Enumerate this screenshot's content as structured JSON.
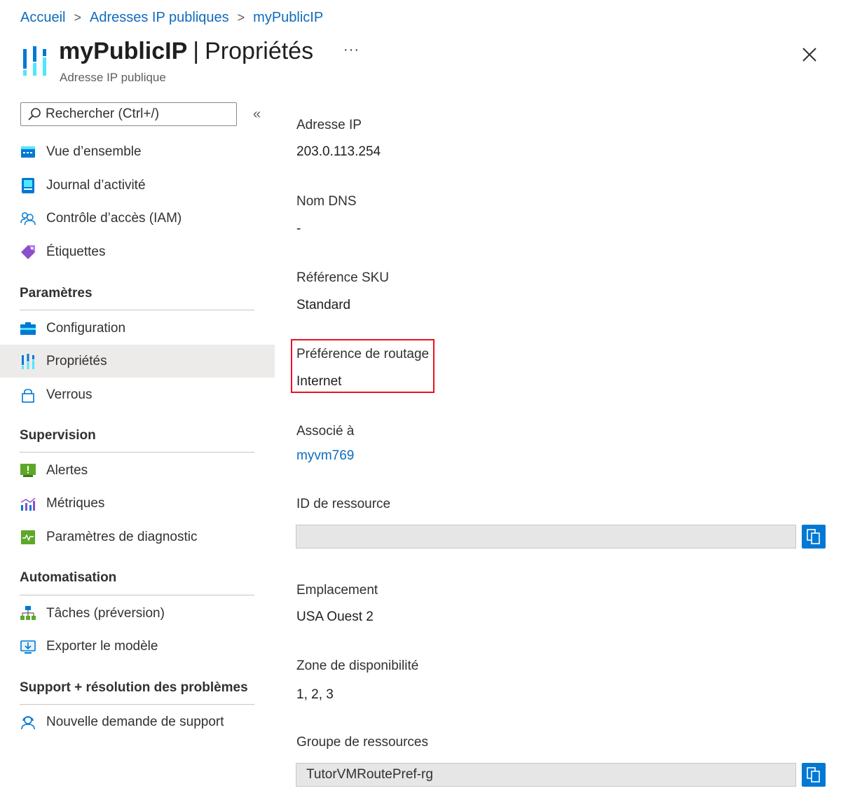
{
  "breadcrumb": {
    "items": [
      "Accueil",
      "Adresses IP publiques",
      "myPublicIP"
    ],
    "separator": ">"
  },
  "header": {
    "resource_name": "myPublicIP",
    "separator": "|",
    "page_name": "Propriétés",
    "subtitle": "Adresse IP publique",
    "more_label": "···",
    "close_label": "×"
  },
  "search": {
    "placeholder": "Rechercher (Ctrl+/)",
    "collapse_label": "«"
  },
  "nav": {
    "items_top": [
      {
        "label": "Vue d’ensemble",
        "icon": "overview-icon"
      },
      {
        "label": "Journal d’activité",
        "icon": "activity-log-icon"
      },
      {
        "label": "Contrôle d’accès (IAM)",
        "icon": "people-icon"
      },
      {
        "label": "Étiquettes",
        "icon": "tag-icon"
      }
    ],
    "sections": [
      {
        "title": "Paramètres",
        "items": [
          {
            "label": "Configuration",
            "icon": "configuration-icon"
          },
          {
            "label": "Propriétés",
            "icon": "properties-icon",
            "active": true
          },
          {
            "label": "Verrous",
            "icon": "lock-icon"
          }
        ]
      },
      {
        "title": "Supervision",
        "items": [
          {
            "label": "Alertes",
            "icon": "alert-icon"
          },
          {
            "label": "Métriques",
            "icon": "metrics-icon"
          },
          {
            "label": "Paramètres de diagnostic",
            "icon": "diagnostic-icon"
          }
        ]
      },
      {
        "title": "Automatisation",
        "items": [
          {
            "label": "Tâches (préversion)",
            "icon": "tasks-icon"
          },
          {
            "label": "Exporter le modèle",
            "icon": "export-icon"
          }
        ]
      },
      {
        "title": "Support + résolution des problèmes",
        "items": [
          {
            "label": "Nouvelle demande de support",
            "icon": "support-icon"
          }
        ]
      }
    ]
  },
  "properties": {
    "ip_address": {
      "label": "Adresse IP",
      "value": "203.0.113.254"
    },
    "dns_name": {
      "label": "Nom DNS",
      "value": "-"
    },
    "sku": {
      "label": "Référence SKU",
      "value": "Standard"
    },
    "routing_preference": {
      "label": "Préférence de routage",
      "value": "Internet"
    },
    "associated_to": {
      "label": "Associé à",
      "value": "myvm769"
    },
    "resource_id": {
      "label": "ID de ressource",
      "value": ""
    },
    "location": {
      "label": "Emplacement",
      "value": "USA Ouest 2"
    },
    "availability_zone": {
      "label": "Zone de disponibilité",
      "value": "1, 2, 3"
    },
    "resource_group": {
      "label": "Groupe de ressources",
      "value": "TutorVMRoutePref-rg"
    }
  },
  "colors": {
    "accent": "#0078d4",
    "link": "#0f6cbd",
    "highlight_border": "#e81123",
    "active_nav_bg": "#edebe9"
  }
}
